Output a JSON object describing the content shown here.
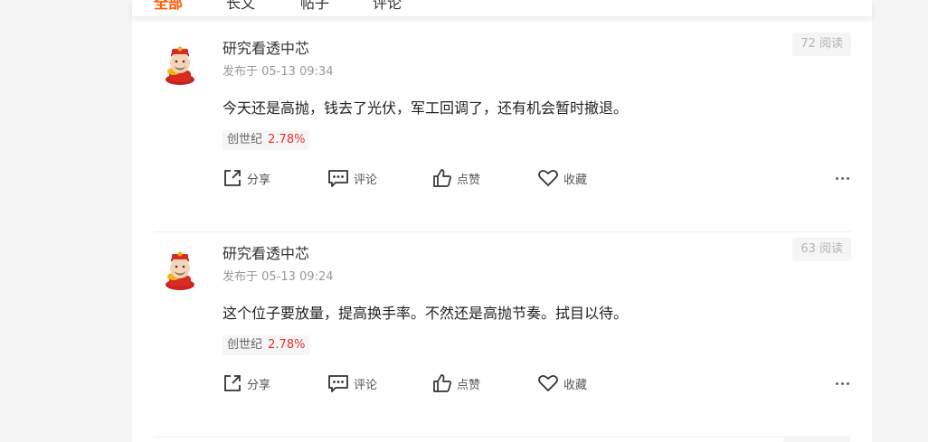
{
  "tabs": [
    {
      "label": "全部",
      "active": true
    },
    {
      "label": "长文",
      "active": false
    },
    {
      "label": "帖子",
      "active": false
    },
    {
      "label": "评论",
      "active": false
    }
  ],
  "posts": [
    {
      "author": "研究看透中芯",
      "time": "发布于 05-13 09:34",
      "reads": "72 阅读",
      "content": "今天还是高抛，钱去了光伏，军工回调了，还有机会暂时撤退。",
      "stock": {
        "name": "创世纪",
        "change": "2.78%"
      }
    },
    {
      "author": "研究看透中芯",
      "time": "发布于 05-13 09:24",
      "reads": "63 阅读",
      "content": "这个位子要放量，提高换手率。不然还是高抛节奏。拭目以待。",
      "stock": {
        "name": "创世纪",
        "change": "2.78%"
      }
    }
  ],
  "actions": {
    "share": "分享",
    "comment": "评论",
    "like": "点赞",
    "favorite": "收藏"
  },
  "colors": {
    "accent": "#ff5a00",
    "rise": "#e62e2e"
  }
}
